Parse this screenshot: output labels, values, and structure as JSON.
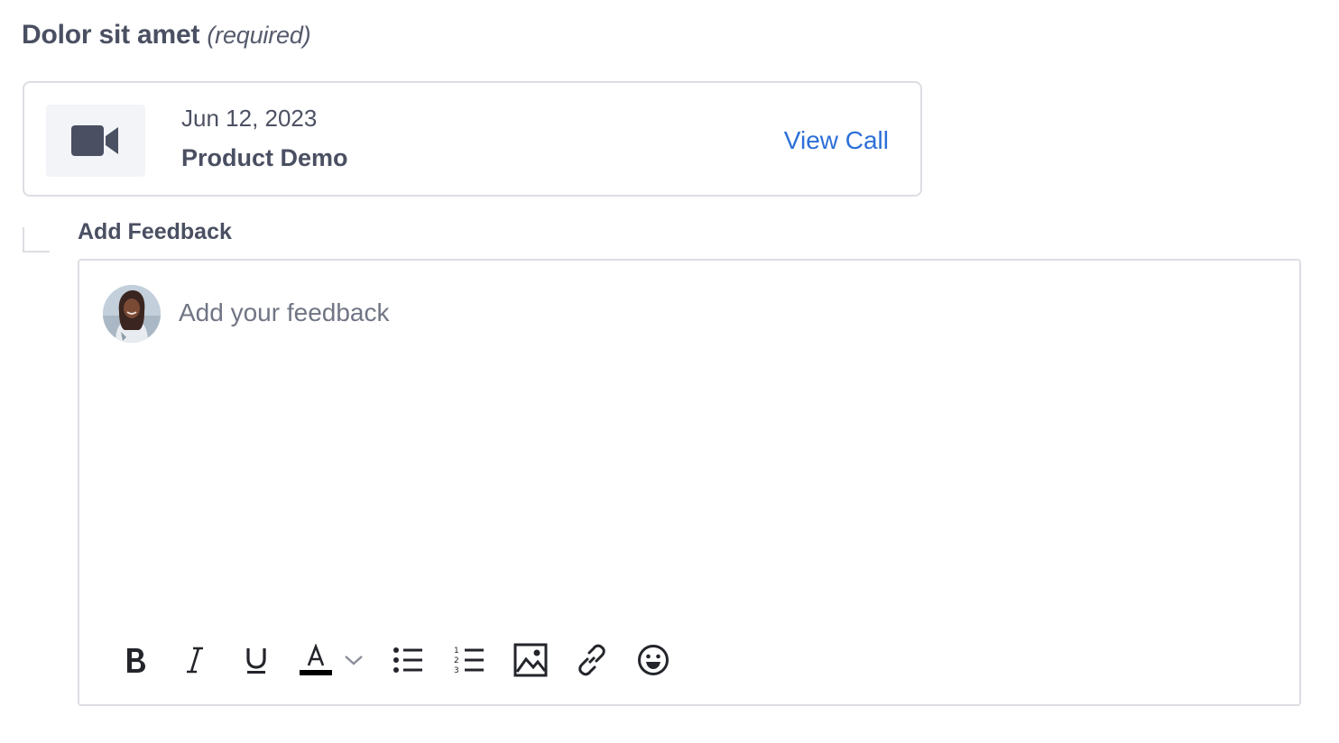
{
  "field": {
    "title": "Dolor sit amet",
    "required_note": "(required)"
  },
  "call_card": {
    "icon": "video-camera-icon",
    "date": "Jun 12, 2023",
    "name": "Product Demo",
    "link_label": "View Call",
    "link_color": "#2c6fd8"
  },
  "feedback": {
    "label": "Add Feedback",
    "placeholder": "Add your feedback",
    "value": ""
  },
  "toolbar": {
    "tools": [
      {
        "name": "bold",
        "icon": "bold-icon"
      },
      {
        "name": "italic",
        "icon": "italic-icon"
      },
      {
        "name": "underline",
        "icon": "underline-icon"
      },
      {
        "name": "text-color",
        "icon": "text-color-icon",
        "current_color": "#000000"
      },
      {
        "name": "text-color-dropdown",
        "icon": "chevron-down-icon"
      },
      {
        "name": "bulleted-list",
        "icon": "bulleted-list-icon"
      },
      {
        "name": "numbered-list",
        "icon": "numbered-list-icon"
      },
      {
        "name": "insert-image",
        "icon": "image-icon"
      },
      {
        "name": "insert-link",
        "icon": "link-icon"
      },
      {
        "name": "insert-emoji",
        "icon": "emoji-icon"
      }
    ]
  }
}
